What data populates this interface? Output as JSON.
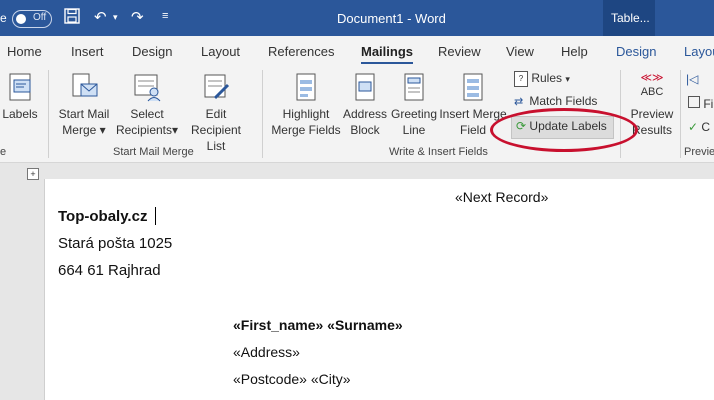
{
  "titlebar": {
    "autosave_prefix": "e",
    "autosave_state": "Off",
    "document_title": "Document1 - Word",
    "context_tab": "Table..."
  },
  "tabs": [
    "Home",
    "Insert",
    "Design",
    "Layout",
    "References",
    "Mailings",
    "Review",
    "View",
    "Help",
    "Design",
    "Layou"
  ],
  "ribbon": {
    "labels": "Labels",
    "start_mail_merge": [
      "Start Mail",
      "Merge"
    ],
    "select_recipients": [
      "Select",
      "Recipients"
    ],
    "edit_recipient_list": [
      "Edit",
      "Recipient List"
    ],
    "highlight_merge_fields": [
      "Highlight",
      "Merge Fields"
    ],
    "address_block": [
      "Address",
      "Block"
    ],
    "greeting_line": [
      "Greeting",
      "Line"
    ],
    "insert_merge_field": [
      "Insert Merge",
      "Field"
    ],
    "rules": "Rules",
    "match_fields": "Match Fields",
    "update_labels": "Update Labels",
    "preview_abc": "ABC",
    "preview_results": [
      "Preview",
      "Results"
    ],
    "partial_fi": "Fi",
    "partial_c": "C",
    "groups": {
      "left_partial": "e",
      "start_mail_merge": "Start Mail Merge",
      "write_insert_fields": "Write & Insert Fields",
      "preview_partial": "Previe"
    }
  },
  "document": {
    "next_record": "«Next Record»",
    "sender": [
      "Top-obaly.cz",
      "Stará pošta 1025",
      "664 61 Rajhrad"
    ],
    "recipient_name": "«First_name» «Surname»",
    "recipient_address": "«Address»",
    "recipient_city": "«Postcode» «City»"
  },
  "colors": {
    "word_blue": "#2b579a",
    "highlight_circle": "#c8102e"
  }
}
